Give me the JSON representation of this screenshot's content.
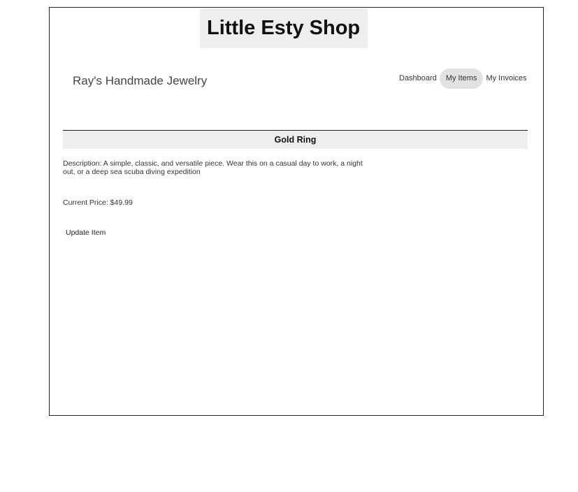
{
  "app": {
    "title": "Little Esty Shop"
  },
  "merchant": {
    "name": "Ray's Handmade Jewelry"
  },
  "nav": {
    "items": [
      {
        "label": "Dashboard",
        "active": false
      },
      {
        "label": "My Items",
        "active": true
      },
      {
        "label": "My Invoices",
        "active": false
      }
    ]
  },
  "item": {
    "name": "Gold Ring",
    "description": "Description: A simple, classic, and versatile piece. Wear this on a casual day to work, a night out, or a deep sea scuba diving expedition",
    "price": "Current Price: $49.99",
    "update_label": "Update Item"
  }
}
